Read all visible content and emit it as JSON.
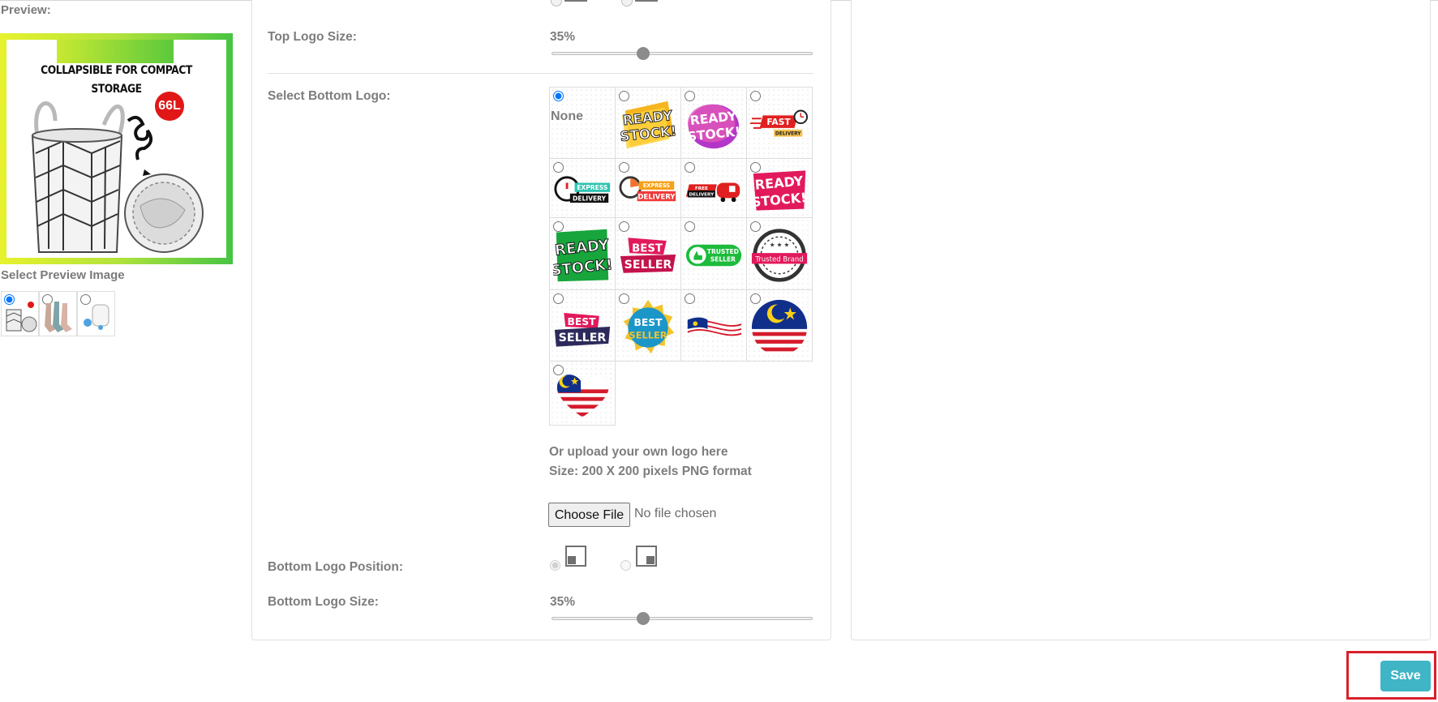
{
  "preview": {
    "label": "Preview:",
    "headline_line1": "COLLAPSIBLE FOR COMPACT",
    "headline_line2": "STORAGE",
    "badge": "66L",
    "select_image_label": "Select Preview Image",
    "thumbnails": [
      {
        "name": "laundry-basket",
        "selected": true
      },
      {
        "name": "socks",
        "selected": false
      },
      {
        "name": "round-container",
        "selected": false
      }
    ]
  },
  "top_logo": {
    "size_label": "Top Logo Size:",
    "size_value": "35%",
    "size_fraction": 0.35
  },
  "bottom_logo": {
    "select_label": "Select Bottom Logo:",
    "none_label": "None",
    "options": [
      {
        "icon": "none",
        "selected": true
      },
      {
        "icon": "ready-stock-yellow-icon",
        "text": "READY STOCK!"
      },
      {
        "icon": "ready-stock-purple-icon",
        "text": "READY STOCK!"
      },
      {
        "icon": "fast-delivery-icon",
        "text": "FAST DELIVERY"
      },
      {
        "icon": "express-delivery-stopwatch-icon",
        "text": "EXPRESS DELIVERY"
      },
      {
        "icon": "express-delivery-orange-icon",
        "text": "EXPRESS DELIVERY"
      },
      {
        "icon": "free-delivery-truck-icon",
        "text": "FREE DELIVERY"
      },
      {
        "icon": "ready-stock-pink-icon",
        "text": "READY STOCK!"
      },
      {
        "icon": "ready-stock-green-icon",
        "text": "READY STOCK!"
      },
      {
        "icon": "best-seller-pink-ribbon-icon",
        "text": "BEST SELLER"
      },
      {
        "icon": "trusted-seller-icon",
        "text": "TRUSTED SELLER"
      },
      {
        "icon": "trusted-brand-icon",
        "text": "Trusted Brand"
      },
      {
        "icon": "best-seller-navy-icon",
        "text": "BEST SELLER"
      },
      {
        "icon": "best-seller-seal-icon",
        "text": "BEST SELLER"
      },
      {
        "icon": "malaysia-flag-wave-icon"
      },
      {
        "icon": "malaysia-flag-circle-icon"
      },
      {
        "icon": "malaysia-flag-heart-icon"
      }
    ],
    "upload_line1": "Or upload your own logo here",
    "upload_line2": "Size: 200 X 200 pixels PNG format",
    "choose_file_label": "Choose File",
    "file_status": "No file chosen",
    "position_label": "Bottom Logo Position:",
    "positions": [
      {
        "name": "bottom-left",
        "selected": true
      },
      {
        "name": "bottom-right",
        "selected": false
      }
    ],
    "size_label": "Bottom Logo Size:",
    "size_value": "35%",
    "size_fraction": 0.35
  },
  "actions": {
    "save_label": "Save"
  },
  "colors": {
    "save": "#3fb5c6",
    "focus_outline": "#d9202c",
    "frame_gradient_start": "#e7f22c",
    "frame_gradient_end": "#47c443"
  }
}
